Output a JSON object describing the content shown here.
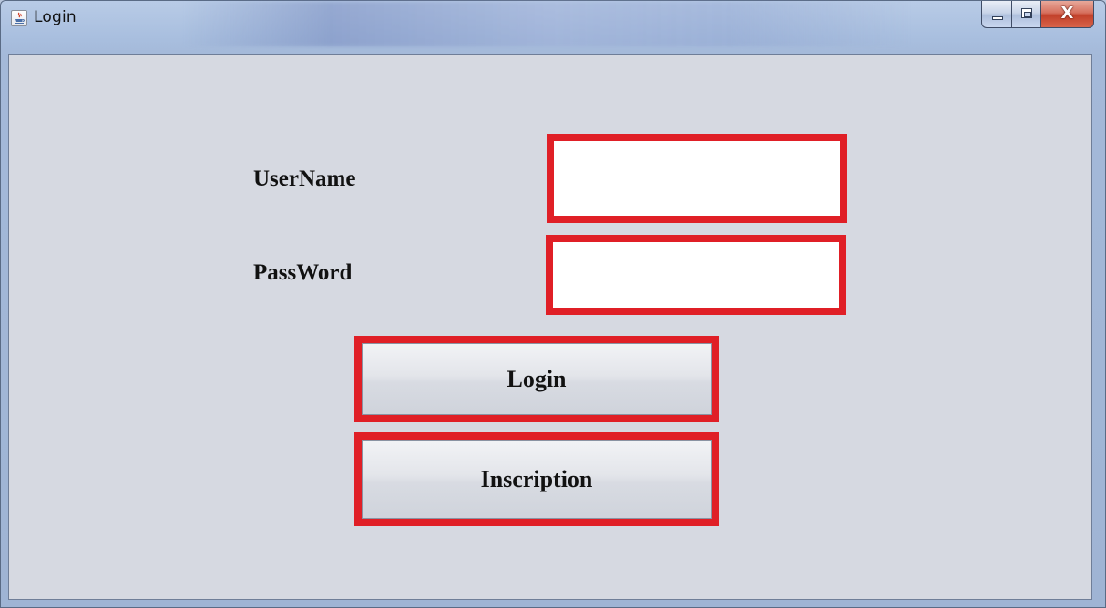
{
  "window": {
    "title": "Login",
    "controls": {
      "minimize_icon": "minimize-icon",
      "maximize_icon": "maximize-icon",
      "close_label": "X"
    }
  },
  "form": {
    "username_label": "UserName",
    "username_value": "",
    "password_label": "PassWord",
    "password_value": "",
    "login_button": "Login",
    "inscription_button": "Inscription"
  },
  "colors": {
    "highlight_border": "#e01f26",
    "client_background": "#d6d9e1",
    "titlebar": "#a9bfdf"
  }
}
